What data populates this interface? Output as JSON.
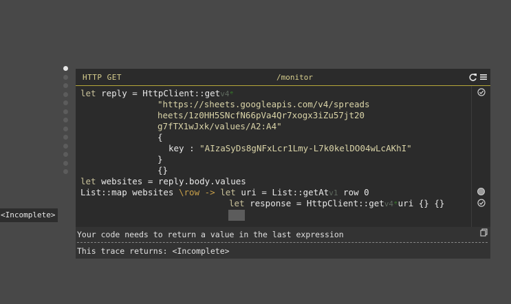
{
  "incomplete_label": "<Incomplete>",
  "header": {
    "method": "HTTP  GET",
    "path": "/monitor"
  },
  "code": {
    "l1_kw": "let",
    "l1_rest": " reply = HttpClient::get",
    "l1_ver": "v4",
    "l2": "\"https://sheets.googleapis.com/v4/spreads",
    "l3": "heets/1z0HH5SNcfN66pVa4Qr7xogx3iZu57jt20",
    "l4": "g7fTX1wJxk/values/A2:A4\"",
    "l5": "{",
    "l6_key": "key",
    "l6_sep": " : ",
    "l6_val": "\"AIzaSyDs8gNFxLcr1Lmy-L7k0kelDO04wLcAKhI\"",
    "l7": "}",
    "l8": "{}",
    "l9_kw": "let",
    "l9_rest": " websites = reply.body.values",
    "l10_a": "List::map websites ",
    "l10_lambda": "\\row ->",
    "l10_kw": " let",
    "l10_b": " uri = List::getAt",
    "l10_ver": "v1",
    "l10_c": " row 0",
    "l11_kw": "let",
    "l11_a": " response = HttpClient::get",
    "l11_ver": "v4",
    "l11_b": "uri {} {}"
  },
  "result": {
    "message": "Your code needs to return a value in the last expression",
    "trace": "This trace returns: <Incomplete>"
  },
  "icons": {
    "refresh": "refresh-icon",
    "menu": "hamburger-menu-icon",
    "check": "check-circle-icon",
    "copy": "copy-icon"
  }
}
